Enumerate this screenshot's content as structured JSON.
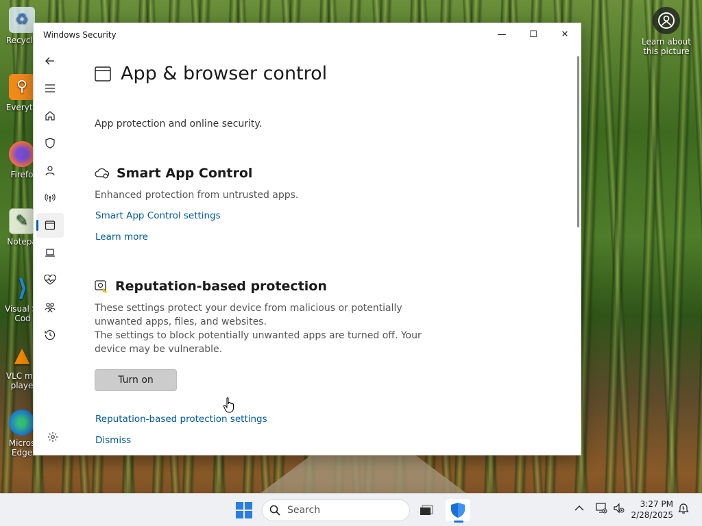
{
  "desktop": {
    "icons": [
      {
        "label": "Recycle",
        "icon": "recycle-bin-icon"
      },
      {
        "label": "Everyth",
        "icon": "everything-search-icon"
      },
      {
        "label": "Firefo",
        "icon": "firefox-icon"
      },
      {
        "label": "Notepa",
        "icon": "notepad-icon"
      },
      {
        "label": "Visual St Cod",
        "icon": "vscode-icon"
      },
      {
        "label": "VLC me playe",
        "icon": "vlc-icon"
      },
      {
        "label": "Micros Edge",
        "icon": "edge-icon"
      }
    ],
    "learn_picture": "Learn about this picture"
  },
  "window": {
    "title": "Windows Security",
    "controls": {
      "minimize": "—",
      "maximize": "☐",
      "close": "✕"
    }
  },
  "nav": {
    "items": [
      {
        "icon": "back-arrow-icon"
      },
      {
        "icon": "hamburger-menu-icon"
      },
      {
        "icon": "home-icon"
      },
      {
        "icon": "shield-icon"
      },
      {
        "icon": "account-person-icon"
      },
      {
        "icon": "firewall-network-icon"
      },
      {
        "icon": "app-browser-icon",
        "active": true
      },
      {
        "icon": "device-security-laptop-icon"
      },
      {
        "icon": "device-health-heart-icon"
      },
      {
        "icon": "family-options-icon"
      },
      {
        "icon": "protection-history-icon"
      }
    ],
    "settings_icon": "gear-icon"
  },
  "page": {
    "title": "App & browser control",
    "subtitle": "App protection and online security.",
    "smart_app": {
      "title": "Smart App Control",
      "desc": "Enhanced protection from untrusted apps.",
      "link_settings": "Smart App Control settings",
      "link_learn": "Learn more"
    },
    "reputation": {
      "title": "Reputation-based protection",
      "desc1": "These settings protect your device from malicious or potentially unwanted apps, files, and websites.",
      "desc2": "The settings to block potentially unwanted apps are turned off. Your device may be vulnerable.",
      "button": "Turn on",
      "link_settings": "Reputation-based protection settings",
      "link_dismiss": "Dismiss"
    }
  },
  "taskbar": {
    "search_placeholder": "Search",
    "time": "3:27 PM",
    "date": "2/28/2025"
  },
  "colors": {
    "accent": "#005fb8",
    "link": "#005a9e"
  }
}
